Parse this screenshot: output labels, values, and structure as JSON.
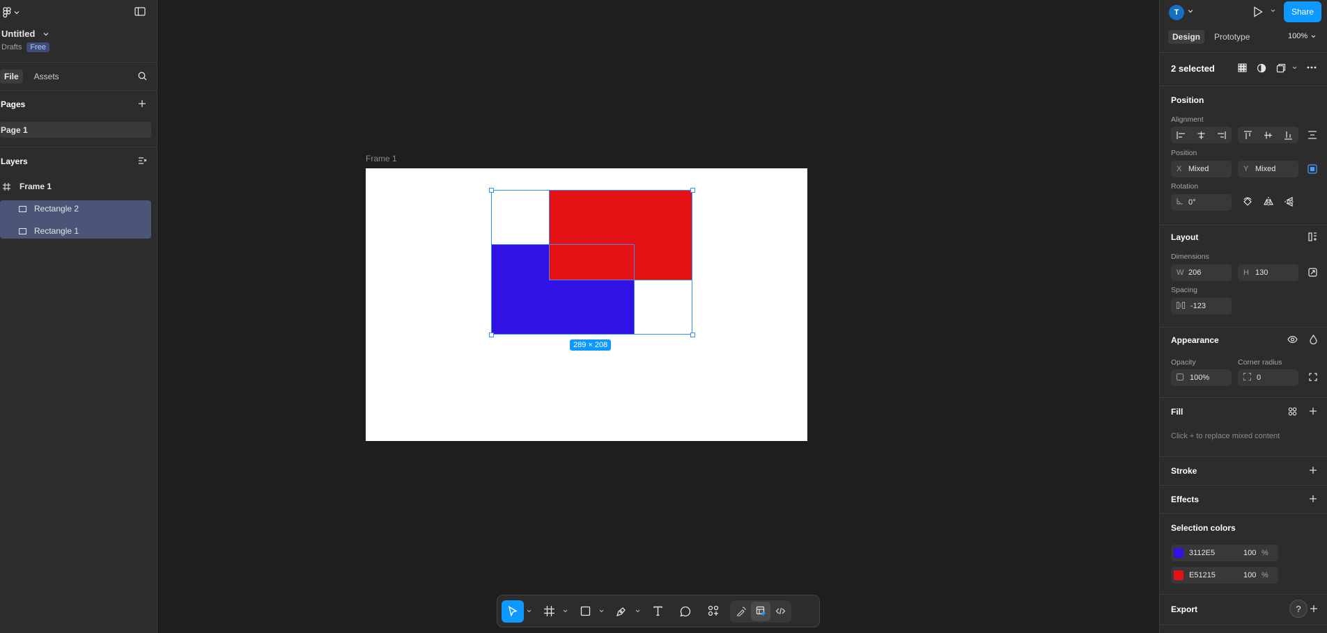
{
  "left_panel": {
    "file_name": "Untitled",
    "location": "Drafts",
    "plan_badge": "Free",
    "tabs": {
      "file": "File",
      "assets": "Assets"
    },
    "pages_title": "Pages",
    "pages": [
      "Page 1"
    ],
    "layers_title": "Layers",
    "layers": {
      "frame": "Frame 1",
      "children": [
        "Rectangle 2",
        "Rectangle 1"
      ]
    }
  },
  "canvas": {
    "frame_label": "Frame 1",
    "selection_size": "289 × 208"
  },
  "right_panel": {
    "avatar_initial": "T",
    "share_label": "Share",
    "tabs": {
      "design": "Design",
      "prototype": "Prototype"
    },
    "zoom": "100%",
    "selection_count": "2 selected",
    "position": {
      "title": "Position",
      "alignment_label": "Alignment",
      "position_label": "Position",
      "x_prefix": "X",
      "x_value": "Mixed",
      "y_prefix": "Y",
      "y_value": "Mixed",
      "rotation_label": "Rotation",
      "rotation_value": "0°"
    },
    "layout": {
      "title": "Layout",
      "dimensions_label": "Dimensions",
      "w_prefix": "W",
      "w_value": "206",
      "h_prefix": "H",
      "h_value": "130",
      "spacing_label": "Spacing",
      "spacing_value": "-123"
    },
    "appearance": {
      "title": "Appearance",
      "opacity_label": "Opacity",
      "opacity_value": "100%",
      "corner_label": "Corner radius",
      "corner_value": "0"
    },
    "fill": {
      "title": "Fill",
      "hint": "Click + to replace mixed content"
    },
    "stroke_title": "Stroke",
    "effects_title": "Effects",
    "selection_colors": {
      "title": "Selection colors",
      "colors": [
        {
          "hex": "3112E5",
          "opacity": "100",
          "unit": "%",
          "color": "#3112E5"
        },
        {
          "hex": "E51215",
          "opacity": "100",
          "unit": "%",
          "color": "#E51215"
        }
      ]
    },
    "export_title": "Export",
    "help_label": "?"
  },
  "colors": {
    "accent": "#0d99ff",
    "blue_rect": "#3112E5",
    "red_rect": "#E51215",
    "selected_layer_bg": "#4a5578"
  }
}
